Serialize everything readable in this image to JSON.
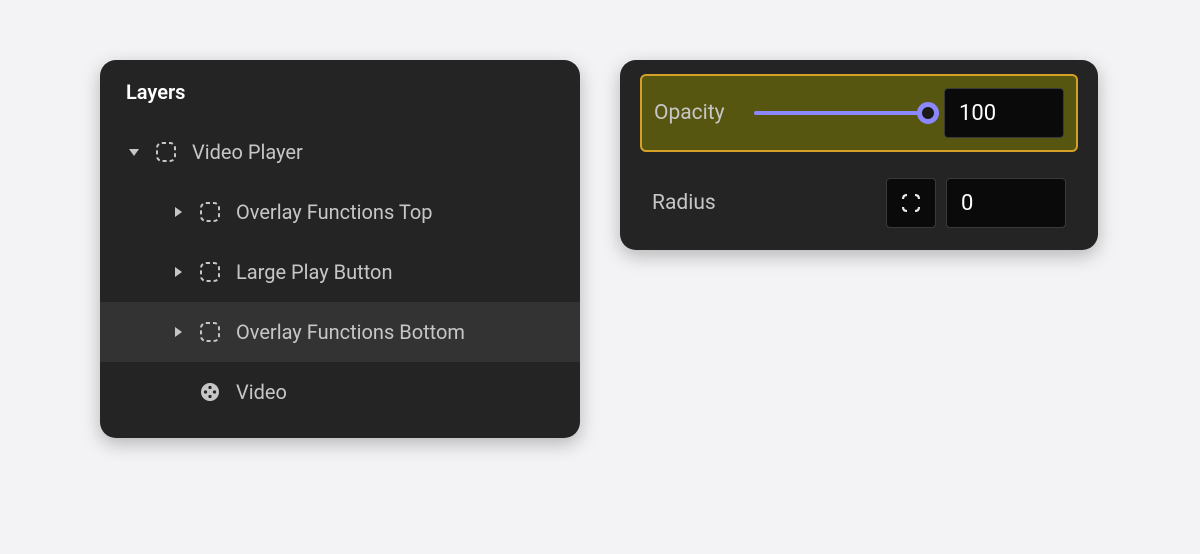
{
  "layers": {
    "title": "Layers",
    "items": [
      {
        "label": "Video Player",
        "depth": 0,
        "expanded": true,
        "icon": "frame",
        "hasChildren": true,
        "selected": false
      },
      {
        "label": "Overlay Functions Top",
        "depth": 1,
        "expanded": false,
        "icon": "frame",
        "hasChildren": true,
        "selected": false
      },
      {
        "label": "Large Play Button",
        "depth": 1,
        "expanded": false,
        "icon": "frame",
        "hasChildren": true,
        "selected": false
      },
      {
        "label": "Overlay Functions Bottom",
        "depth": 1,
        "expanded": false,
        "icon": "frame",
        "hasChildren": true,
        "selected": true
      },
      {
        "label": "Video",
        "depth": 1,
        "expanded": false,
        "icon": "media",
        "hasChildren": false,
        "selected": false
      }
    ]
  },
  "props": {
    "opacity": {
      "label": "Opacity",
      "value": "100",
      "percent": 100
    },
    "radius": {
      "label": "Radius",
      "value": "0"
    }
  },
  "colors": {
    "accent": "#8b88ff",
    "highlight_bg": "rgba(128,128,0,0.55)",
    "highlight_border": "#d4a028"
  }
}
